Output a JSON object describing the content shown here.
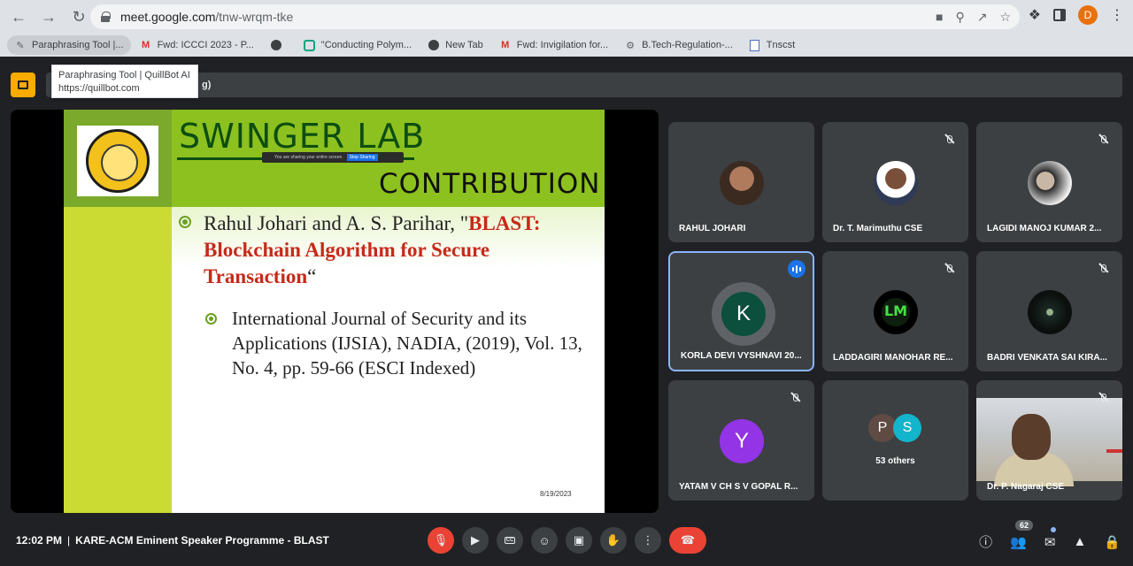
{
  "browser": {
    "url_host": "meet.google.com",
    "url_path": "/tnw-wrqm-tke",
    "profile_initial": "D",
    "profile_color": "#e8710a"
  },
  "bookmarks": [
    {
      "label": "Paraphrasing Tool |...",
      "icon": "pen-icon"
    },
    {
      "label": "Fwd: ICCCI 2023 - P...",
      "icon": "gmail-icon"
    },
    {
      "label": "",
      "icon": "globe-icon"
    },
    {
      "label": "\"Conducting Polym...",
      "icon": "chatgpt-icon"
    },
    {
      "label": "New Tab",
      "icon": "globe-icon"
    },
    {
      "label": "Fwd: Invigilation for...",
      "icon": "gmail-icon"
    },
    {
      "label": "B.Tech-Regulation-...",
      "icon": "gear-icon"
    },
    {
      "label": "Tnscst",
      "icon": "sheet-icon"
    }
  ],
  "tooltip": {
    "title": "Paraphrasing Tool | QuillBot AI",
    "url": "https://quillbot.com"
  },
  "banner": {
    "text": "g)"
  },
  "slide": {
    "title": "SWINGER LAB",
    "subtitle": "CONTRIBUTION",
    "share_text": "You are sharing your entire screen.",
    "share_stop": "Stop Sharing",
    "ref_authors": "Rahul Johari and A. S. Parihar, \"",
    "ref_title": "BLAST: Blockchain Algorithm for Secure Transaction",
    "ref_close": "“",
    "journal": "International Journal of Security and its Applications (IJSIA), NADIA, (2019), Vol. 13, No. 4, pp. 59-66 (ESCI Indexed)",
    "date": "8/19/2023"
  },
  "participants": [
    {
      "name": "RAHUL JOHARI",
      "muted": false
    },
    {
      "name": "Dr. T. Marimuthu CSE",
      "muted": true
    },
    {
      "name": "LAGIDI MANOJ KUMAR 2...",
      "muted": true
    },
    {
      "name": "KORLA DEVI VYSHNAVI 20...",
      "initial": "K",
      "color": "#0b4f3c",
      "speaking": true
    },
    {
      "name": "LADDAGIRI MANOHAR RE...",
      "muted": true,
      "logo_text": "LM"
    },
    {
      "name": "BADRI VENKATA SAI KIRA...",
      "muted": true
    },
    {
      "name": "YATAM V CH S V GOPAL R...",
      "initial": "Y",
      "color": "#9334e6",
      "muted": true
    },
    {
      "name": "53 others",
      "avatars": [
        {
          "initial": "P",
          "color": "#5f4a44"
        },
        {
          "initial": "S",
          "color": "#12b5cb"
        }
      ]
    },
    {
      "name": "Dr. P. Nagaraj CSE",
      "muted": true
    }
  ],
  "meeting": {
    "time": "12:02 PM",
    "separator": "|",
    "title": "KARE-ACM Eminent Speaker Programme - BLAST",
    "participant_count": "62"
  }
}
